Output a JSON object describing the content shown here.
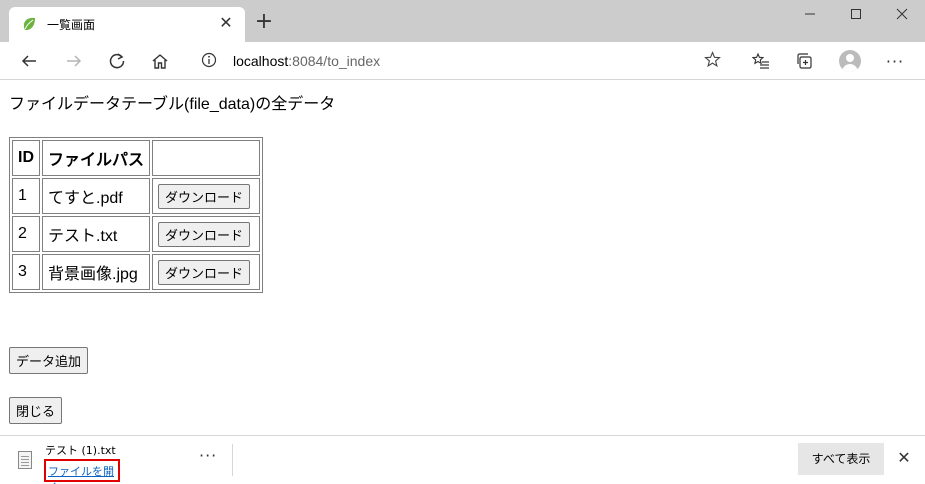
{
  "browser": {
    "tab_title": "一覧画面",
    "tab_close": "✕",
    "new_tab": "+",
    "address_host": "localhost",
    "address_rest": ":8084/to_index",
    "more": "···"
  },
  "page": {
    "heading": "ファイルデータテーブル(file_data)の全データ",
    "table": {
      "headers": [
        "ID",
        "ファイルパス",
        ""
      ],
      "rows": [
        {
          "id": "1",
          "path": "てすと.pdf",
          "button": "ダウンロード"
        },
        {
          "id": "2",
          "path": "テスト.txt",
          "button": "ダウンロード"
        },
        {
          "id": "3",
          "path": "背景画像.jpg",
          "button": "ダウンロード"
        }
      ]
    },
    "add_button": "データ追加",
    "close_button": "閉じる"
  },
  "download_bar": {
    "file_name": "テスト (1).txt",
    "open_link": "ファイルを開く",
    "more": "···",
    "show_all": "すべて表示",
    "close": "✕"
  },
  "icons": {
    "favicon": "spring-leaf-icon",
    "back": "back-arrow-icon",
    "forward": "forward-arrow-icon",
    "reload": "reload-icon",
    "home": "home-icon",
    "info": "info-icon",
    "star": "star-icon",
    "favorites": "favorites-icon",
    "collections": "collections-icon",
    "profile": "profile-icon"
  },
  "colors": {
    "favicon_green": "#6db33f",
    "link_blue": "#0b62c4",
    "highlight_red": "#e00000"
  }
}
